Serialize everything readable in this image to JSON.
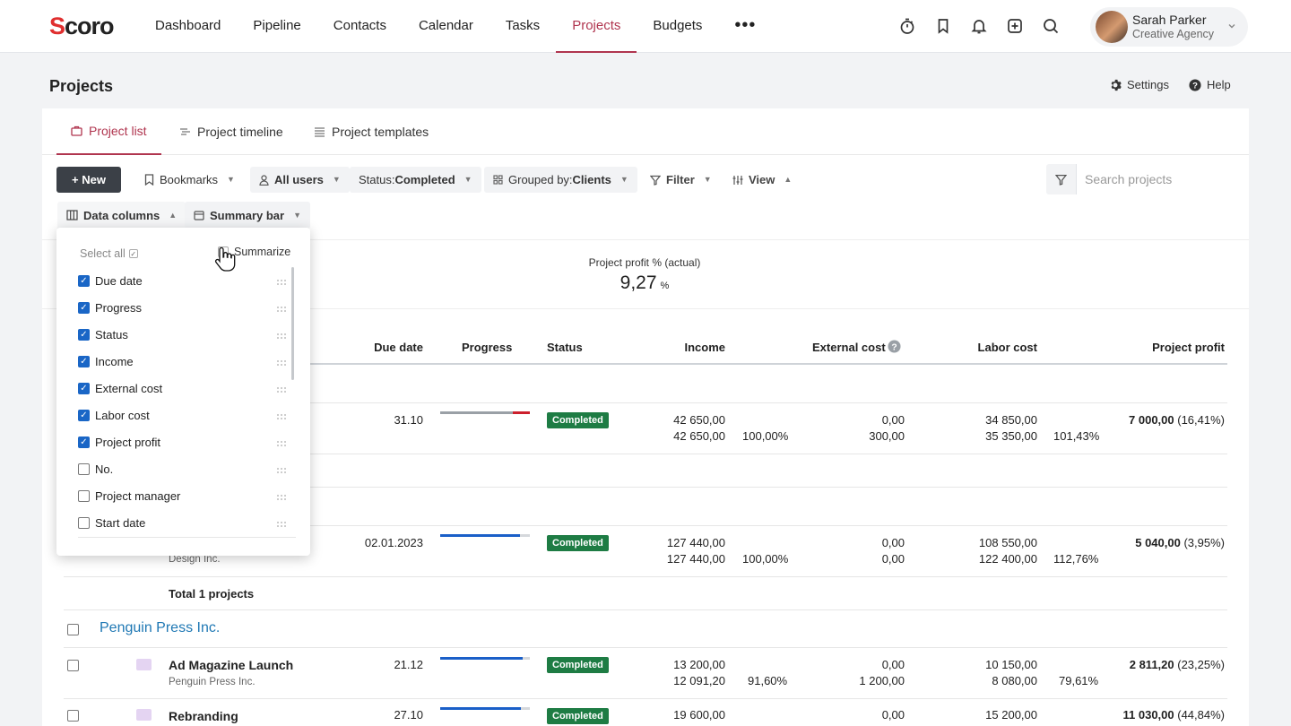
{
  "app": {
    "logo_accent": "S",
    "logo_rest": "coro"
  },
  "nav": {
    "items": [
      "Dashboard",
      "Pipeline",
      "Contacts",
      "Calendar",
      "Tasks",
      "Projects",
      "Budgets"
    ],
    "active": "Projects",
    "more": "•••"
  },
  "top_icons": [
    "timer-icon",
    "bookmark-icon",
    "bell-icon",
    "plus-square-icon",
    "search-icon"
  ],
  "user": {
    "name": "Sarah Parker",
    "org": "Creative Agency"
  },
  "page": {
    "title": "Projects",
    "settings": "Settings",
    "help": "Help"
  },
  "tabs": [
    "Project list",
    "Project timeline",
    "Project templates"
  ],
  "toolbar": {
    "new": "+ New",
    "bookmarks": "Bookmarks",
    "all_users": "All users",
    "status_prefix": "Status: ",
    "status_value": "Completed",
    "grouped_prefix": "Grouped by: ",
    "grouped_value": "Clients",
    "filter": "Filter",
    "view": "View",
    "data_columns": "Data columns",
    "summary_bar": "Summary bar"
  },
  "search": {
    "placeholder": "Search projects"
  },
  "summary": {
    "label": "Project profit % (actual)",
    "value": "9,27",
    "unit": "%"
  },
  "columns": {
    "due_date": "Due date",
    "progress": "Progress",
    "status": "Status",
    "income": "Income",
    "external_cost": "External cost",
    "labor_cost": "Labor cost",
    "project_profit": "Project profit"
  },
  "rows": [
    {
      "due": "31.10",
      "progress": 1.0,
      "overrun": true,
      "status": "Completed",
      "income1": "42 650,00",
      "income2": "42 650,00",
      "income_pct": "100,00%",
      "ext1": "0,00",
      "ext2": "300,00",
      "labor1": "34 850,00",
      "labor2": "35 350,00",
      "labor_pct": "101,43%",
      "profit": "7 000,00",
      "profit_pct": "(16,41%)"
    },
    {
      "due": "02.01.2023",
      "client_sub": "Design Inc.",
      "progress": 0.89,
      "overrun": false,
      "status": "Completed",
      "income1": "127 440,00",
      "income2": "127 440,00",
      "income_pct": "100,00%",
      "ext1": "0,00",
      "ext2": "0,00",
      "labor1": "108 550,00",
      "labor2": "122 400,00",
      "labor_pct": "112,76%",
      "profit": "5 040,00",
      "profit_pct": "(3,95%)"
    }
  ],
  "total_label": "Total 1 projects",
  "group": {
    "name": "Penguin Press Inc.",
    "projects": [
      {
        "name": "Ad Magazine Launch",
        "client": "Penguin Press Inc.",
        "due": "21.12",
        "progress": 0.92,
        "status": "Completed",
        "income1": "13 200,00",
        "income2": "12 091,20",
        "income_pct": "91,60%",
        "ext1": "0,00",
        "ext2": "1 200,00",
        "labor1": "10 150,00",
        "labor2": "8 080,00",
        "labor_pct": "79,61%",
        "profit": "2 811,20",
        "profit_pct": "(23,25%)"
      },
      {
        "name": "Rebranding",
        "client": "",
        "due": "27.10",
        "progress": 0.9,
        "status": "Completed",
        "income1": "19 600,00",
        "ext1": "0,00",
        "labor1": "15 200,00",
        "profit": "11 030,00",
        "profit_pct": "(44,84%)"
      }
    ]
  },
  "dropdown": {
    "select_all": "Select all",
    "summarize": "Summarize",
    "items": [
      {
        "label": "Due date",
        "checked": true
      },
      {
        "label": "Progress",
        "checked": true
      },
      {
        "label": "Status",
        "checked": true
      },
      {
        "label": "Income",
        "checked": true
      },
      {
        "label": "External cost",
        "checked": true
      },
      {
        "label": "Labor cost",
        "checked": true
      },
      {
        "label": "Project profit",
        "checked": true
      },
      {
        "label": "No.",
        "checked": false
      },
      {
        "label": "Project manager",
        "checked": false
      },
      {
        "label": "Start date",
        "checked": false
      }
    ]
  },
  "colors": {
    "accent": "#b0354f",
    "completed": "#1e7c44",
    "progress_blue": "#1a5fc8",
    "progress_red": "#cc1f2c",
    "link": "#1f78b4",
    "checkbox": "#1a66c6"
  }
}
